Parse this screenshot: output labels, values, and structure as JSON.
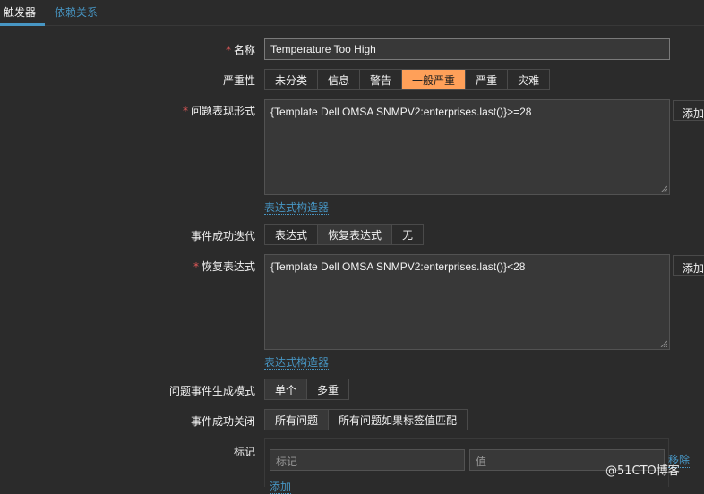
{
  "tabs": {
    "triggers": "触发器",
    "dependencies": "依赖关系"
  },
  "form": {
    "name": {
      "label": "名称",
      "value": "Temperature Too High"
    },
    "severity": {
      "label": "严重性",
      "options": [
        "未分类",
        "信息",
        "警告",
        "一般严重",
        "严重",
        "灾难"
      ],
      "selected": "一般严重"
    },
    "problem_expression": {
      "label": "问题表现形式",
      "value": "{Template Dell OMSA SNMPV2:enterprises.last()}>=28",
      "add_label": "添加",
      "builder_link": "表达式构造器"
    },
    "ok_event_generation": {
      "label": "事件成功迭代",
      "options": [
        "表达式",
        "恢复表达式",
        "无"
      ],
      "selected": "恢复表达式"
    },
    "recovery_expression": {
      "label": "恢复表达式",
      "value": "{Template Dell OMSA SNMPV2:enterprises.last()}<28",
      "add_label": "添加",
      "builder_link": "表达式构造器"
    },
    "problem_event_mode": {
      "label": "问题事件生成模式",
      "options": [
        "单个",
        "多重"
      ],
      "selected": "单个"
    },
    "ok_event_closes": {
      "label": "事件成功关闭",
      "options": [
        "所有问题",
        "所有问题如果标签值匹配"
      ],
      "selected": "所有问题"
    },
    "tags": {
      "label": "标记",
      "tag_placeholder": "标记",
      "value_placeholder": "值",
      "remove_label": "移除",
      "add_label": "添加"
    }
  },
  "watermark": "@51CTO博客",
  "colors": {
    "background": "#2b2b2b",
    "link": "#4796c4",
    "selected_severity": "#ffa059",
    "required": "#e45959"
  }
}
